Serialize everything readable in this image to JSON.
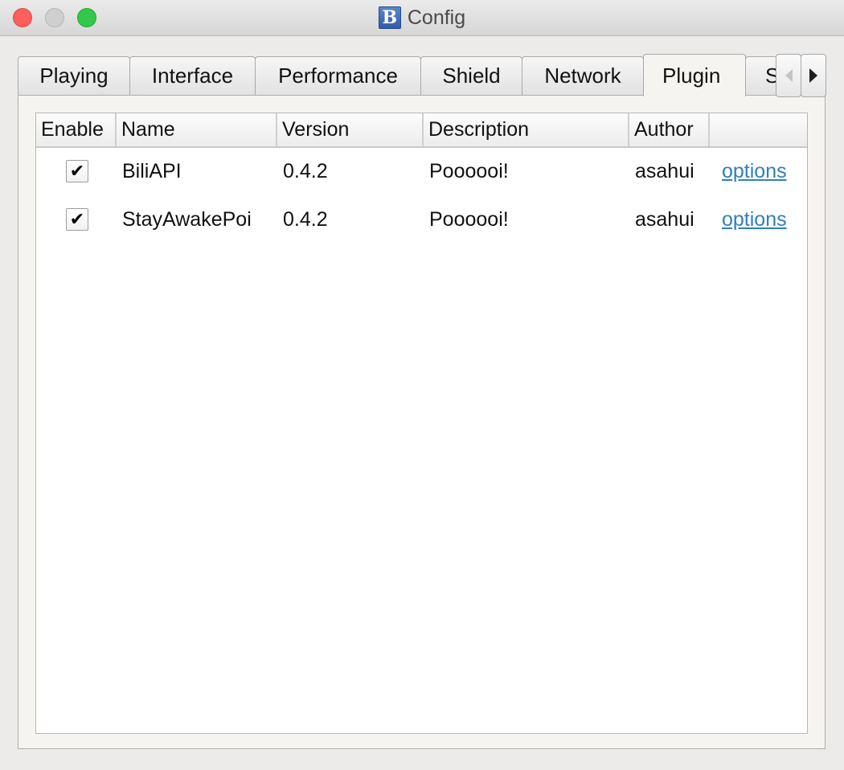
{
  "window": {
    "title": "Config",
    "app_icon_letter": "B"
  },
  "tabs": [
    {
      "label": "Playing",
      "active": false
    },
    {
      "label": "Interface",
      "active": false
    },
    {
      "label": "Performance",
      "active": false
    },
    {
      "label": "Shield",
      "active": false
    },
    {
      "label": "Network",
      "active": false
    },
    {
      "label": "Plugin",
      "active": true
    },
    {
      "label": "S",
      "active": false
    }
  ],
  "table": {
    "columns": [
      "Enable",
      "Name",
      "Version",
      "Description",
      "Author",
      ""
    ],
    "rows": [
      {
        "enabled": true,
        "check_glyph": "✔",
        "name": "BiliAPI",
        "version": "0.4.2",
        "description": "Poooooi!",
        "author": "asahui",
        "action": "options"
      },
      {
        "enabled": true,
        "check_glyph": "✔",
        "name": "StayAwakePoi",
        "version": "0.4.2",
        "description": "Poooooi!",
        "author": "asahui",
        "action": "options"
      }
    ]
  },
  "colors": {
    "link": "#2f7fbf",
    "close": "#fc605c",
    "minimize": "#cfcfcf",
    "zoom": "#34c84a"
  }
}
